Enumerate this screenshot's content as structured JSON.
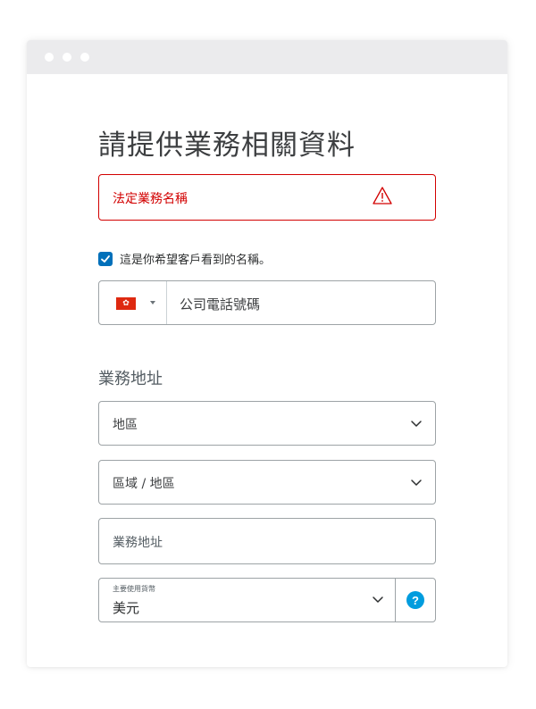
{
  "page_title": "請提供業務相關資料",
  "legal_name": {
    "label": "法定業務名稱",
    "state": "error",
    "icon": "warning-icon"
  },
  "checkbox": {
    "checked": true,
    "label": "這是你希望客戶看到的名稱。"
  },
  "phone": {
    "country_flag": "hong-kong-flag-icon",
    "placeholder": "公司電話號碼"
  },
  "business_address": {
    "heading": "業務地址",
    "region_placeholder": "地區",
    "district_placeholder": "區域 / 地區",
    "address_placeholder": "業務地址"
  },
  "currency": {
    "label": "主要使用貨幣",
    "value": "美元",
    "help_label": "?"
  },
  "colors": {
    "error": "#d20000",
    "accent": "#0070ba",
    "help": "#009cde",
    "titlebar": "#ebebed",
    "border": "#9da3a6"
  }
}
